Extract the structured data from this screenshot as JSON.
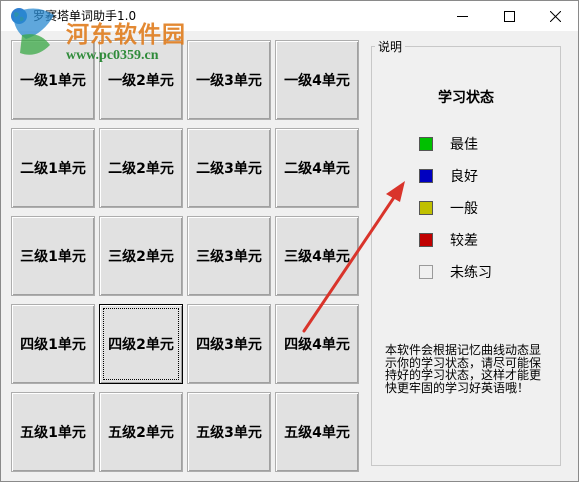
{
  "window": {
    "title": "罗赛塔单词助手1.0",
    "controls": {
      "minimize_icon": "minimize-icon",
      "maximize_icon": "maximize-icon",
      "close_icon": "close-icon"
    }
  },
  "watermark": {
    "site": "河东软件园",
    "url": "www.pc0359.cn"
  },
  "units": [
    [
      "一级1单元",
      "一级2单元",
      "一级3单元",
      "一级4单元"
    ],
    [
      "二级1单元",
      "二级2单元",
      "二级3单元",
      "二级4单元"
    ],
    [
      "三级1单元",
      "三级2单元",
      "三级3单元",
      "三级4单元"
    ],
    [
      "四级1单元",
      "四级2单元",
      "四级3单元",
      "四级4单元"
    ],
    [
      "五级1单元",
      "五级2单元",
      "五级3单元",
      "五级4单元"
    ]
  ],
  "focused_unit": "四级2单元",
  "panel": {
    "group_title": "说明",
    "heading": "学习状态",
    "legend": [
      {
        "label": "最佳",
        "color": "#00c000"
      },
      {
        "label": "良好",
        "color": "#0000c0"
      },
      {
        "label": "一般",
        "color": "#c0c000"
      },
      {
        "label": "较差",
        "color": "#c00000"
      },
      {
        "label": "未练习",
        "color": "#f0f0f0"
      }
    ],
    "description": "本软件会根据记忆曲线动态显示你的学习状态，请尽可能保持好的学习状态，这样才能更快更牢固的学习好英语哦！"
  },
  "annotation": {
    "arrow_color": "#d9342b"
  }
}
